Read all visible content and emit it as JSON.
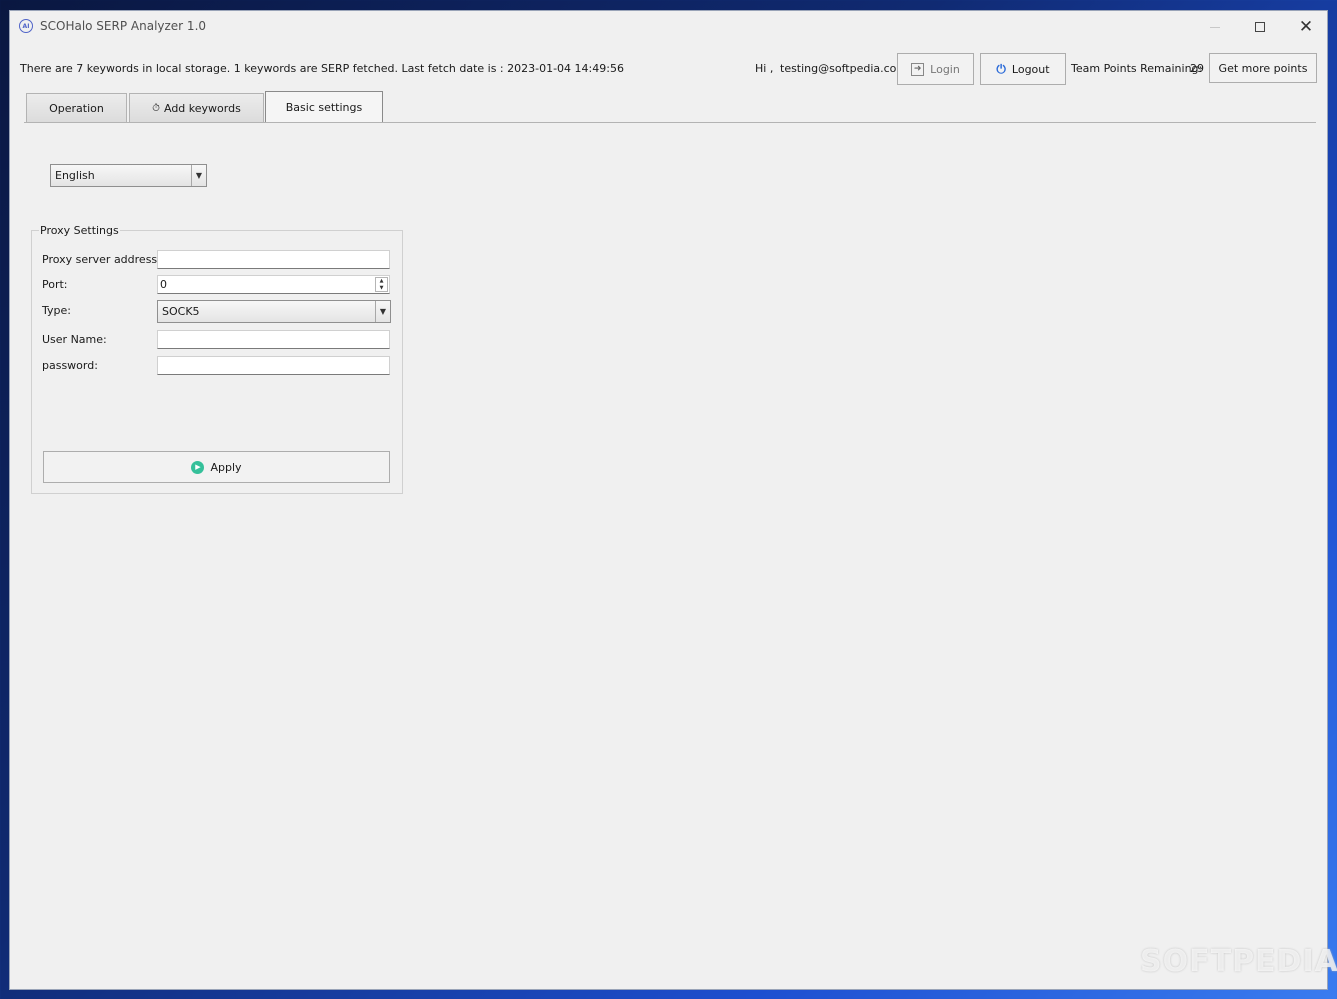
{
  "window": {
    "title": "SCOHalo SERP Analyzer 1.0",
    "icon": "ai-app-icon",
    "controls": {
      "minimize": "minimize-icon",
      "maximize": "maximize-icon",
      "close": "close-icon"
    }
  },
  "header": {
    "status_text": "There are 7 keywords in local storage.  1 keywords are SERP fetched.  Last fetch date is : 2023-01-04 14:49:56",
    "greeting": "Hi ,",
    "user_email": "testing@softpedia.com",
    "login_label": "Login",
    "logout_label": "Logout",
    "points_label": "Team Points Remaining:",
    "points_value": "29",
    "get_more_points_label": "Get more points"
  },
  "tabs": [
    {
      "label": "Operation",
      "active": false
    },
    {
      "label": "Add keywords",
      "active": false
    },
    {
      "label": "Basic settings",
      "active": true
    }
  ],
  "settings": {
    "language": {
      "selected": "English"
    },
    "proxy": {
      "group_title": "Proxy Settings",
      "address_label": "Proxy server address:",
      "address_value": "",
      "port_label": "Port:",
      "port_value": "0",
      "type_label": "Type:",
      "type_selected": "SOCK5",
      "username_label": "User Name:",
      "username_value": "",
      "password_label": "password:",
      "password_value": "",
      "apply_label": "Apply"
    }
  },
  "watermark": "SOFTPEDIA",
  "colors": {
    "accent_power": "#2a6ad8",
    "apply_icon": "#35c09a",
    "window_bg": "#f0f0f0"
  }
}
